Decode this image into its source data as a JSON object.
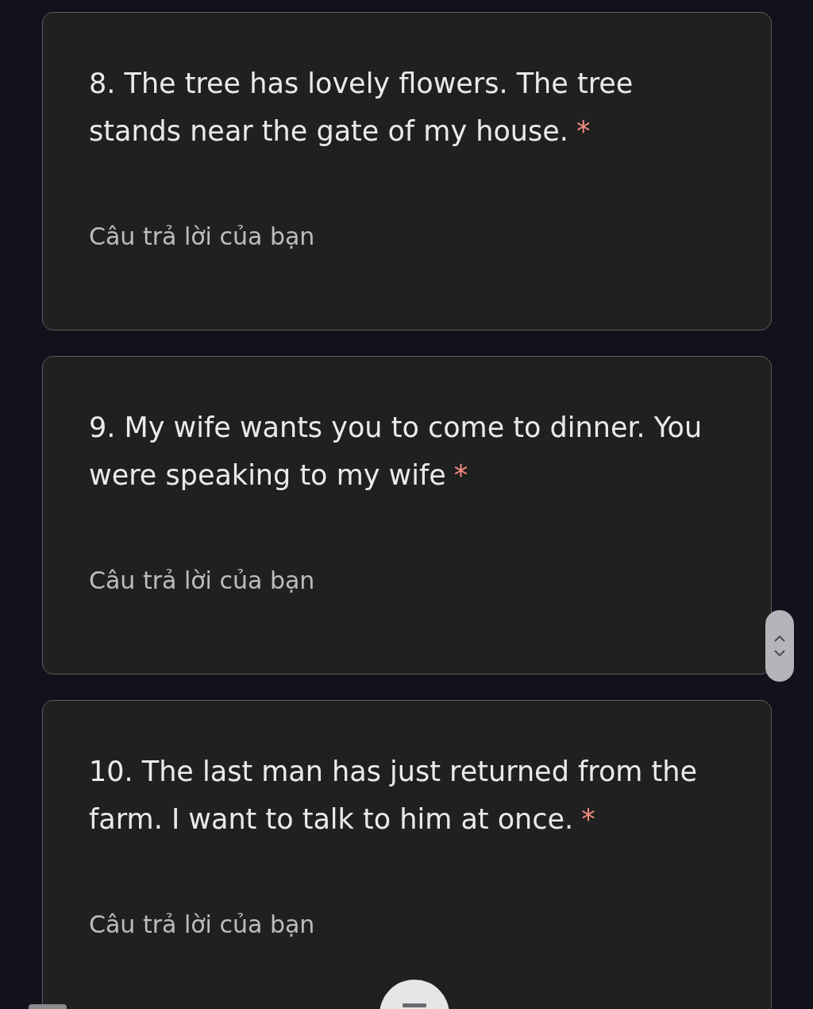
{
  "questions": [
    {
      "text": "8. The tree has lovely flowers. The tree stands near the gate of my house.",
      "required_mark": "*",
      "answer": {
        "placeholder": "Câu trả lời của bạn"
      }
    },
    {
      "text": "9. My wife wants you to come to dinner. You were speaking to my wife",
      "required_mark": "*",
      "answer": {
        "placeholder": "Câu trả lời của bạn"
      }
    },
    {
      "text": "10. The last man has just returned from the farm. I want to talk to him at once.",
      "required_mark": "*",
      "answer": {
        "placeholder": "Câu trả lời của bạn"
      }
    }
  ]
}
